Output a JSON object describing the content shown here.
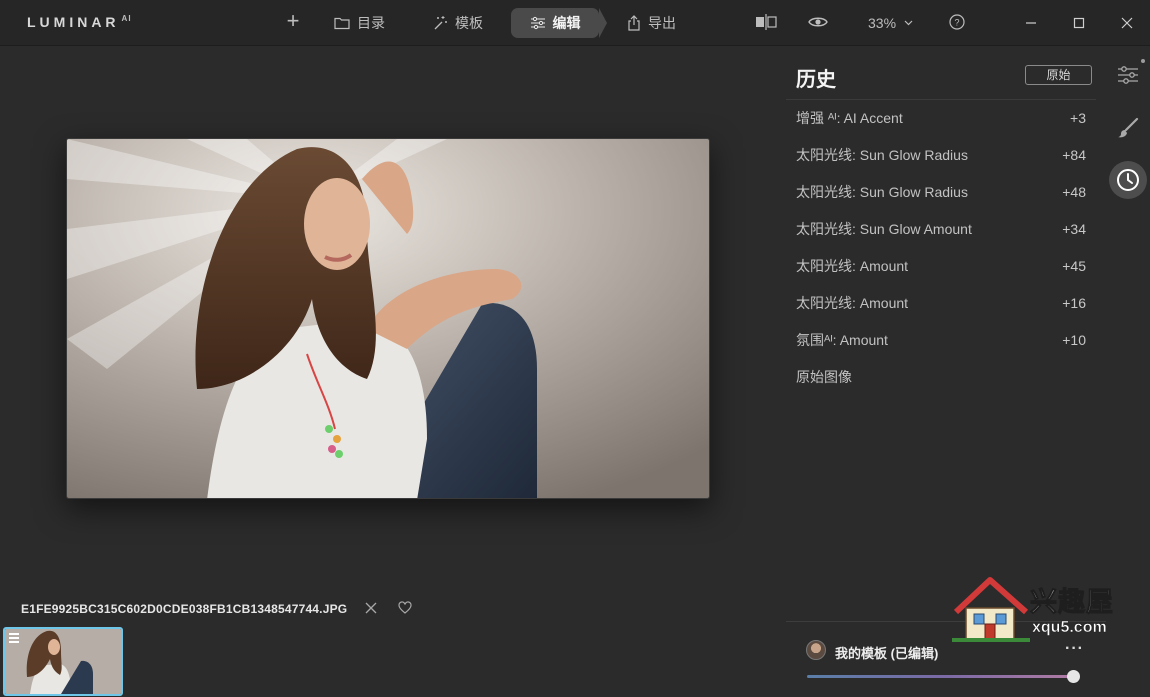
{
  "app": {
    "logo_text": "LUMINAR",
    "logo_sup": "AI"
  },
  "toolbar": {
    "add_label": "+",
    "tabs": [
      {
        "label": "目录",
        "icon": "folder-icon"
      },
      {
        "label": "模板",
        "icon": "magic-wand-icon"
      },
      {
        "label": "编辑",
        "icon": "sliders-icon",
        "active": true
      },
      {
        "label": "导出",
        "icon": "share-icon"
      }
    ],
    "zoom": "33%"
  },
  "panel": {
    "title": "历史",
    "original_button": "原始",
    "history": [
      {
        "label": "增强 ᴬᴵ: AI Accent",
        "value": "+3"
      },
      {
        "label": "太阳光线: Sun Glow Radius",
        "value": "+84"
      },
      {
        "label": "太阳光线: Sun Glow Radius",
        "value": "+48"
      },
      {
        "label": "太阳光线: Sun Glow Amount",
        "value": "+34"
      },
      {
        "label": "太阳光线: Amount",
        "value": "+45"
      },
      {
        "label": "太阳光线: Amount",
        "value": "+16"
      },
      {
        "label": "氛围ᴬᴵ: Amount",
        "value": "+10"
      },
      {
        "label": "原始图像",
        "value": ""
      }
    ],
    "template_name": "我的模板 (已编辑)",
    "more_label": "···",
    "template_strength": 1.0
  },
  "canvas": {
    "filename": "E1FE9925BC315C602D0CDE038FB1CB1348547744.JPG"
  },
  "watermark": {
    "brand": "兴趣屋",
    "site": "xqu5.com"
  },
  "colors": {
    "background": "#2b2b2b",
    "topbar": "#262626",
    "active_tab": "#4a4a4a",
    "thumbnail_border": "#6ec6e8"
  }
}
